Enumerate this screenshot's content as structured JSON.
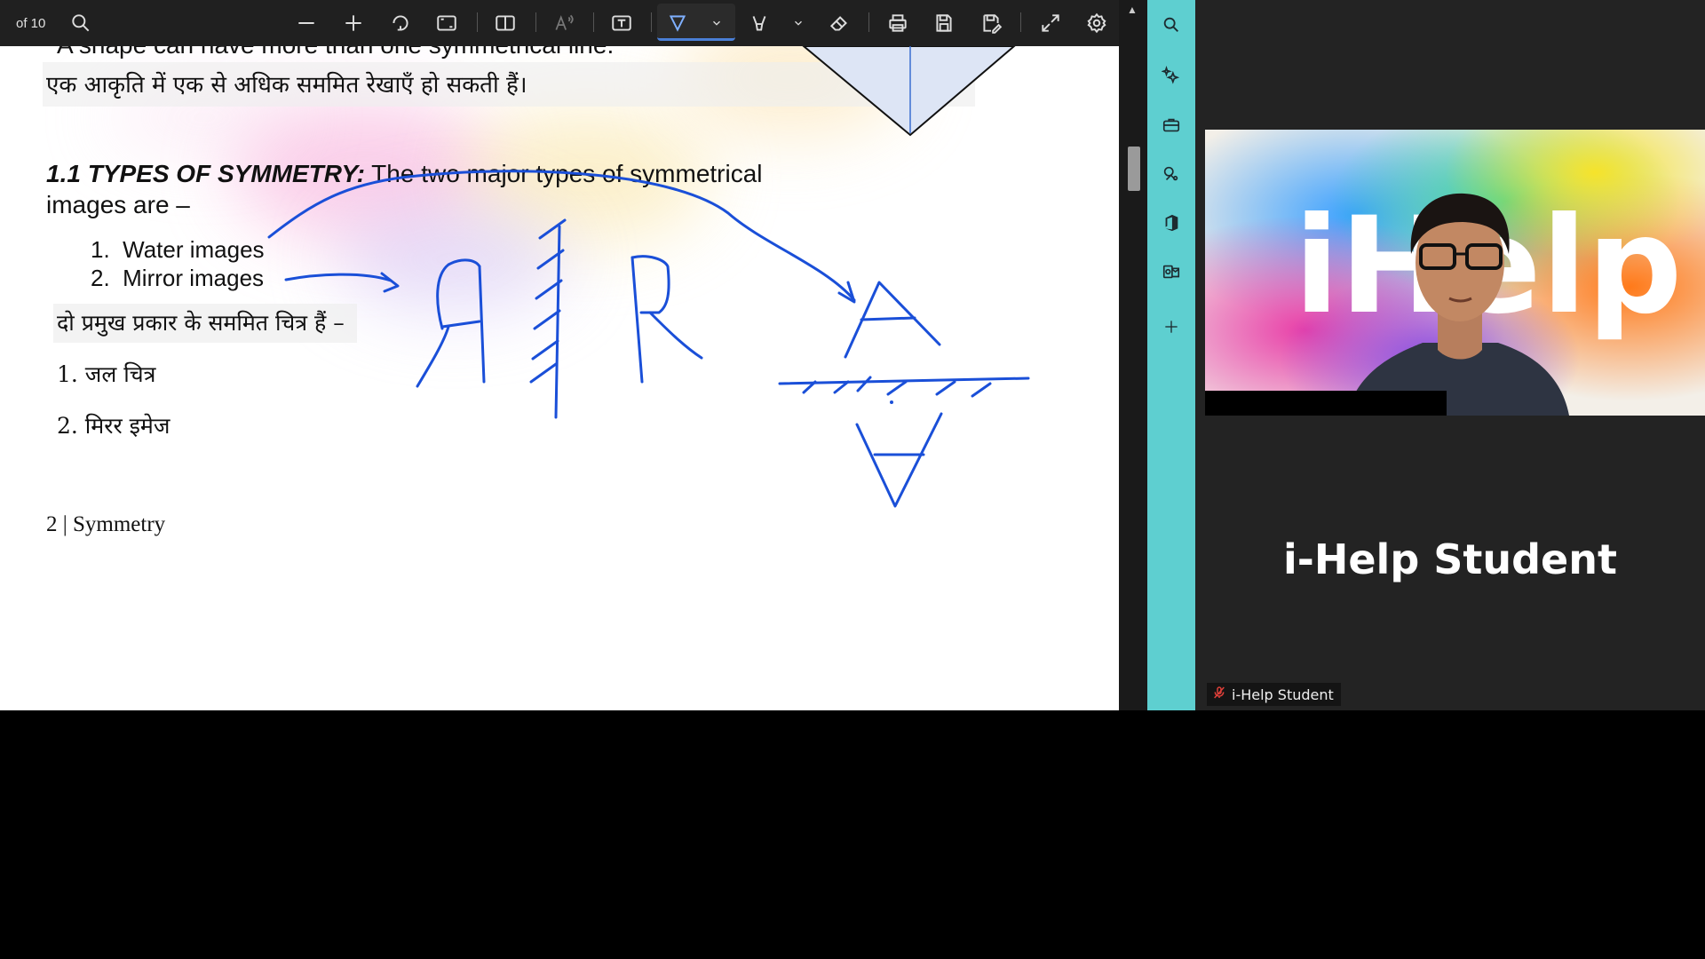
{
  "toolbar": {
    "page_of": "of 10",
    "icons": [
      "search-icon",
      "zoom-out-icon",
      "zoom-in-icon",
      "rotate-icon",
      "fit-page-icon",
      "page-view-icon",
      "read-aloud-icon",
      "text-box-icon",
      "draw-icon",
      "highlight-icon",
      "eraser-icon",
      "print-icon",
      "save-icon",
      "save-as-icon",
      "fullscreen-icon",
      "settings-icon"
    ],
    "accent": "#4a7fd6"
  },
  "document": {
    "top_cut_line": "A shape can have more than one symmetrical line.",
    "hindi_line1": "एक आकृति में एक से अधिक सममित रेखाएँ हो सकती हैं।",
    "heading_bold": "1.1 TYPES OF SYMMETRY:",
    "heading_rest": " The two major types of symmetrical",
    "heading_line2": "images are –",
    "list": [
      {
        "num": "1.",
        "text": "Water images"
      },
      {
        "num": "2.",
        "text": "Mirror images"
      }
    ],
    "hindi_line2": "दो प्रमुख प्रकार के सममित चित्र हैं –",
    "hindi_items": [
      "1. जल चित्र",
      "2. मिरर इमेज"
    ],
    "footer": "2 | Symmetry",
    "ink_color": "#1a4fd8"
  },
  "sidebar": {
    "icons": [
      "search-icon",
      "copilot-icon",
      "briefcase-icon",
      "games-icon",
      "office-icon",
      "outlook-icon",
      "add-icon"
    ],
    "bg": "#5ecfd0"
  },
  "video": {
    "logo_text": "iHelp",
    "participant_name": "i-Help Student",
    "participant_label": "i-Help Student",
    "mic_muted_color": "#e0403a"
  }
}
